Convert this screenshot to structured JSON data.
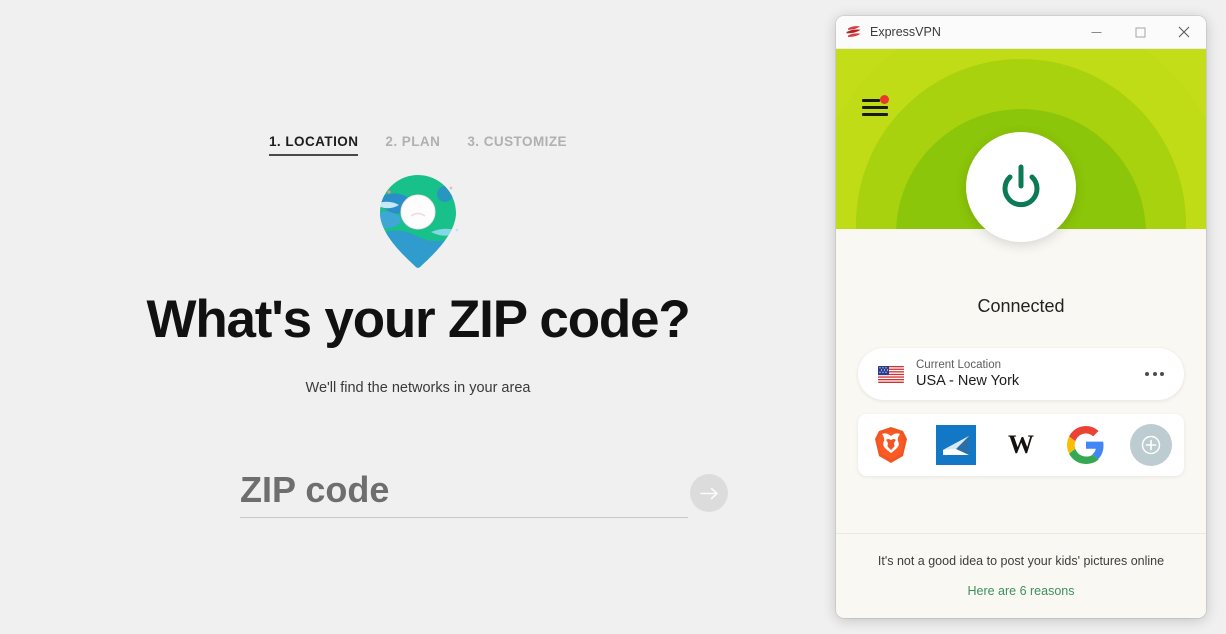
{
  "signup": {
    "steps": [
      {
        "label": "1. LOCATION",
        "active": true
      },
      {
        "label": "2. PLAN",
        "active": false
      },
      {
        "label": "3. CUSTOMIZE",
        "active": false
      }
    ],
    "pin_icon": "location-pin-globe-icon",
    "heading": "What's your ZIP code?",
    "subheading": "We'll find the networks in your area",
    "zip_input": {
      "value": "",
      "placeholder": "ZIP code"
    },
    "submit_icon": "arrow-right-icon",
    "background_color": "#f0f0f0"
  },
  "vpn": {
    "titlebar": {
      "logo_icon": "expressvpn-logo-icon",
      "title": "ExpressVPN",
      "minimize_icon": "minimize-icon",
      "maximize_icon": "maximize-icon",
      "close_icon": "close-icon"
    },
    "hero": {
      "menu_icon": "hamburger-menu-icon",
      "notification_dot_color": "#e8392b",
      "gradient_colors": [
        "#c3de18",
        "#a8d20e",
        "#8cc60a"
      ]
    },
    "power": {
      "icon": "power-icon",
      "icon_color": "#0d7a56",
      "status": "Connected"
    },
    "location": {
      "flag_icon": "usa-flag-icon",
      "label": "Current Location",
      "value": "USA - New York",
      "menu_icon": "more-options-icon"
    },
    "shortcuts": [
      {
        "name": "brave-browser-icon",
        "label": "Brave"
      },
      {
        "name": "mail-app-icon",
        "label": "Mail"
      },
      {
        "name": "wikipedia-icon",
        "label": "Wikipedia"
      },
      {
        "name": "google-icon",
        "label": "Google"
      },
      {
        "name": "add-shortcut-icon",
        "label": "Add shortcut"
      }
    ],
    "footer": {
      "tip": "It's not a good idea to post your kids' pictures online",
      "link": "Here are 6 reasons",
      "link_color": "#3f8f5e"
    }
  }
}
